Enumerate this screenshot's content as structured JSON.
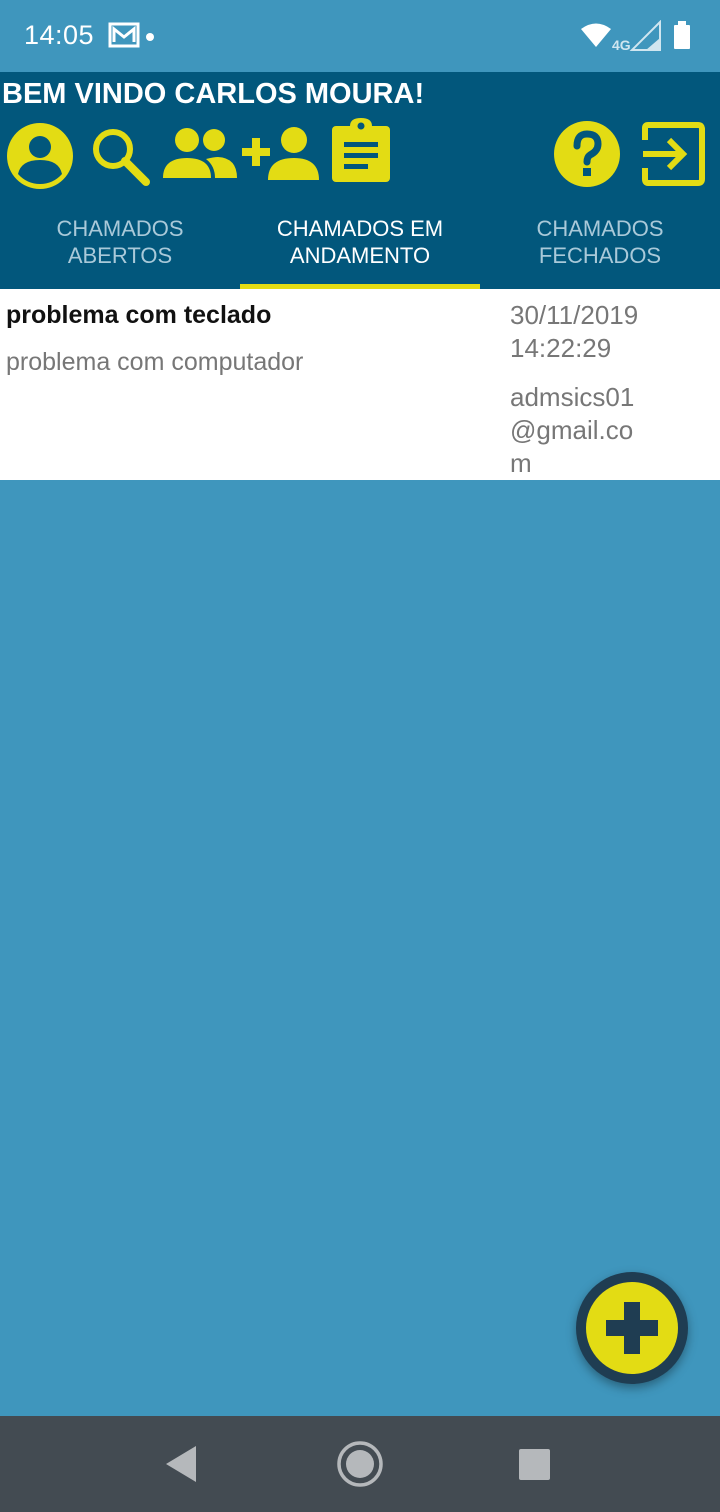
{
  "status_bar": {
    "time": "14:05",
    "network": "4G"
  },
  "header": {
    "welcome": "BEM VINDO CARLOS MOURA!",
    "icons": [
      "account-circle-icon",
      "search-icon",
      "group-icon",
      "person-add-icon",
      "clipboard-icon",
      "help-icon",
      "exit-icon"
    ],
    "icon_color": "#e3dc14",
    "background": "#02577c"
  },
  "tabs": [
    {
      "label_line1": "CHAMADOS",
      "label_line2": "ABERTOS",
      "active": false
    },
    {
      "label_line1": "CHAMADOS EM",
      "label_line2": "ANDAMENTO",
      "active": true
    },
    {
      "label_line1": "CHAMADOS",
      "label_line2": "FECHADOS",
      "active": false
    }
  ],
  "tickets": [
    {
      "title": "problema com teclado",
      "description": "problema com computador",
      "date": "30/11/2019",
      "time": "14:22:29",
      "email": "admsics01@gmail.com"
    }
  ],
  "fab": {
    "icon": "plus-icon"
  },
  "nav": {
    "icons": [
      "back-icon",
      "home-icon",
      "recents-icon"
    ]
  },
  "colors": {
    "accent": "#e3dc14",
    "background": "#3f96bd"
  }
}
